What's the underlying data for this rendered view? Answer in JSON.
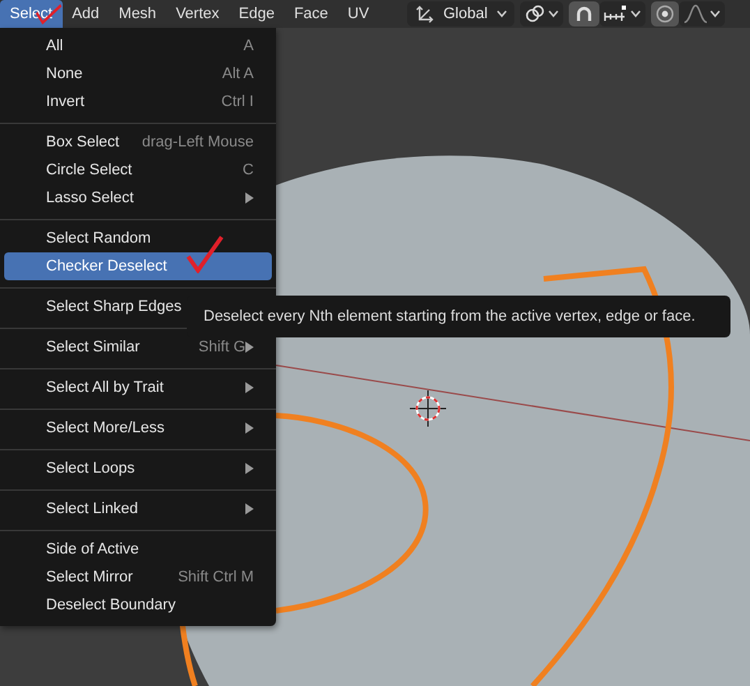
{
  "header": {
    "menus": [
      {
        "label": "Select",
        "selected": true
      },
      {
        "label": "Add",
        "selected": false
      },
      {
        "label": "Mesh",
        "selected": false
      },
      {
        "label": "Vertex",
        "selected": false
      },
      {
        "label": "Edge",
        "selected": false
      },
      {
        "label": "Face",
        "selected": false
      },
      {
        "label": "UV",
        "selected": false
      }
    ],
    "orientation": {
      "value": "Global"
    }
  },
  "menu": {
    "sections": [
      {
        "items": [
          {
            "label": "All",
            "shortcut": "A",
            "submenu": false,
            "highlighted": false
          },
          {
            "label": "None",
            "shortcut": "Alt A",
            "submenu": false,
            "highlighted": false
          },
          {
            "label": "Invert",
            "shortcut": "Ctrl I",
            "submenu": false,
            "highlighted": false
          }
        ]
      },
      {
        "items": [
          {
            "label": "Box Select",
            "shortcut": "drag-Left Mouse",
            "submenu": false,
            "highlighted": false
          },
          {
            "label": "Circle Select",
            "shortcut": "C",
            "submenu": false,
            "highlighted": false
          },
          {
            "label": "Lasso Select",
            "submenu": true,
            "highlighted": false
          }
        ]
      },
      {
        "items": [
          {
            "label": "Select Random",
            "submenu": false,
            "highlighted": false
          },
          {
            "label": "Checker Deselect",
            "submenu": false,
            "highlighted": true
          }
        ]
      },
      {
        "items": [
          {
            "label": "Select Sharp Edges",
            "submenu": false,
            "highlighted": false
          }
        ]
      },
      {
        "items": [
          {
            "label": "Select Similar",
            "shortcut": "Shift G",
            "submenu": true,
            "highlighted": false
          }
        ]
      },
      {
        "items": [
          {
            "label": "Select All by Trait",
            "submenu": true,
            "highlighted": false
          }
        ]
      },
      {
        "items": [
          {
            "label": "Select More/Less",
            "submenu": true,
            "highlighted": false
          }
        ]
      },
      {
        "items": [
          {
            "label": "Select Loops",
            "submenu": true,
            "highlighted": false
          }
        ]
      },
      {
        "items": [
          {
            "label": "Select Linked",
            "submenu": true,
            "highlighted": false
          }
        ]
      },
      {
        "items": [
          {
            "label": "Side of Active",
            "submenu": false,
            "highlighted": false
          },
          {
            "label": "Select Mirror",
            "shortcut": "Shift Ctrl M",
            "submenu": false,
            "highlighted": false
          },
          {
            "label": "Deselect Boundary",
            "submenu": false,
            "highlighted": false
          }
        ]
      }
    ]
  },
  "tooltip": {
    "text": "Deselect every Nth element starting from the active vertex, edge or face."
  }
}
